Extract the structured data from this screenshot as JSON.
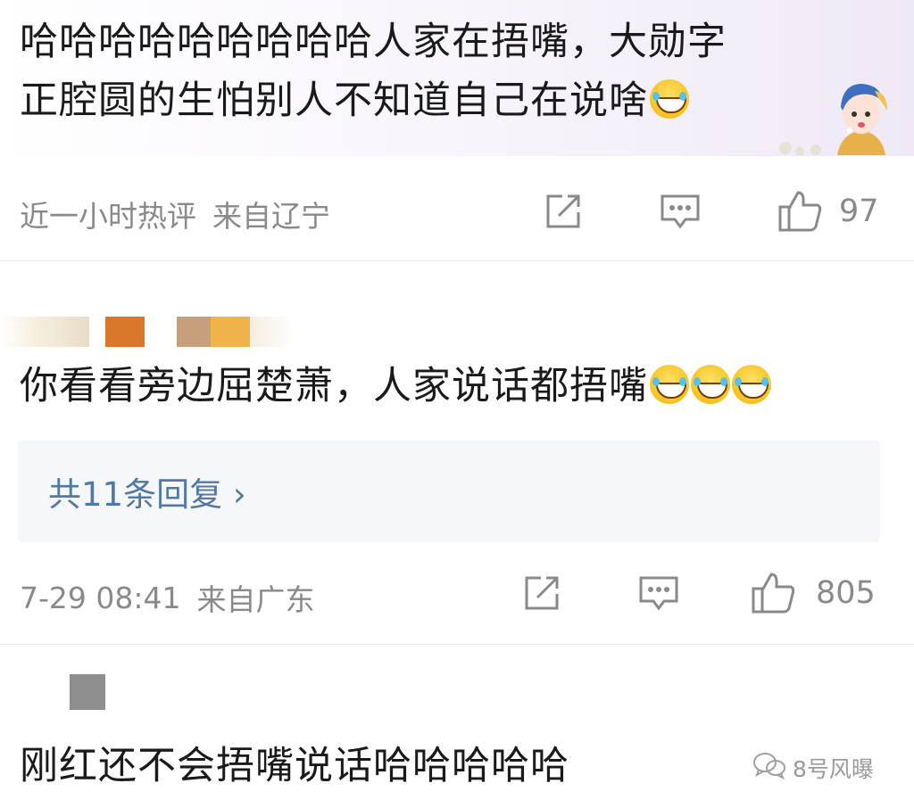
{
  "comments": [
    {
      "text_line1": "哈哈哈哈哈哈哈哈哈人家在捂嘴，大勋字",
      "text_line2": "正腔圆的生怕别人不知道自己在说啥",
      "time": "近一小时热评",
      "location": "来自辽宁",
      "likes": "97"
    },
    {
      "text": "你看看旁边屈楚萧，人家说话都捂嘴",
      "reply_link": "共11条回复 ›",
      "time": "7-29 08:41",
      "location": "来自广东",
      "likes": "805"
    },
    {
      "text": "刚红还不会捂嘴说话哈哈哈哈哈"
    }
  ],
  "watermark": "8号风曝",
  "icons": {
    "share": "share-icon",
    "reply": "comment-icon",
    "like": "thumbs-up-icon",
    "emoji": "laughing-tears-emoji"
  },
  "colors": {
    "link": "#5178a6",
    "meta": "#8a8a8a",
    "reply_bg": "#f6f7f9"
  }
}
